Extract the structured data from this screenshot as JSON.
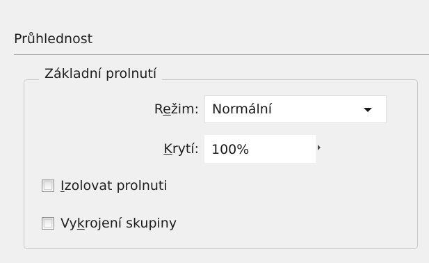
{
  "panel": {
    "title": "Průhlednost"
  },
  "group": {
    "legend": "Základní prolnutí",
    "mode": {
      "label_pre": "R",
      "label_key": "e",
      "label_post": "žim:",
      "value": "Normální"
    },
    "opacity": {
      "label_pre": "",
      "label_key": "K",
      "label_post": "rytí:",
      "value": "100%"
    },
    "isolate": {
      "label_pre": "",
      "label_key": "I",
      "label_post": "zolovat prolnuti",
      "checked": false
    },
    "knockout": {
      "label_pre": "Vy",
      "label_key": "k",
      "label_post": "rojení skupiny",
      "checked": false
    }
  },
  "icons": {
    "dropdown": "chevron-down-icon",
    "stepper": "caret-right-icon"
  },
  "colors": {
    "background": "#f0f0f0",
    "field_background": "#ffffff",
    "text": "#1e1e1e",
    "rule": "#a8a8a8",
    "group_border": "#c8c8c8"
  }
}
